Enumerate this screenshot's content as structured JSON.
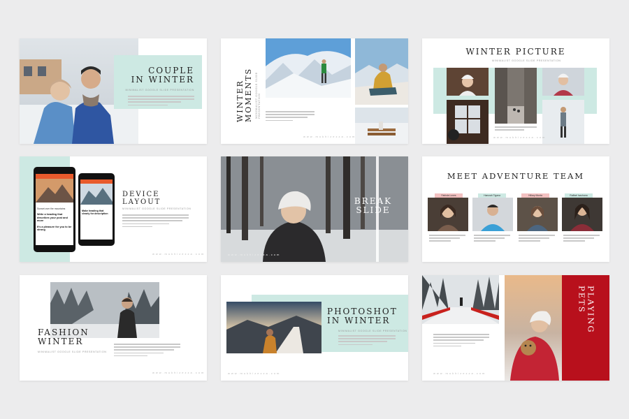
{
  "slides": {
    "couple": {
      "title_line1": "COUPLE",
      "title_line2": "IN WINTER",
      "subtitle": "Minimalist Google Slide Presentation"
    },
    "moments": {
      "title_line1": "WINTER",
      "title_line2": "MOMENTS",
      "subtitle": "Minimalist Google Slide Presentation",
      "url": "www.mukhizezza.com"
    },
    "picture": {
      "title": "WINTER PICTURE",
      "subtitle": "Minimalist Google Slide Presentation",
      "url": "www.mukhizezza.com"
    },
    "device": {
      "title_line1": "DEVICE",
      "title_line2": "LAYOUT",
      "subtitle": "Minimalist Google Slide Presentation",
      "url": "www.mukhizezza.com",
      "phone_text1": "Sunset over the mountains",
      "phone_text2": "Write a heading that describes your post and more",
      "phone_text3": "Make heading that clearly for description",
      "phone_text4": "It's a pleasure for you to be strong"
    },
    "break": {
      "title_line1": "BREAK",
      "title_line2": "SLIDE",
      "url": "www.mukhizezza.com"
    },
    "team": {
      "title": "MEET ADVENTURE TEAM",
      "members": [
        "Fabiola Loves",
        "Hamzah Tigana",
        "Hillary Monta",
        "Raffael Isachana"
      ]
    },
    "fashion": {
      "title_line1": "FASHION",
      "title_line2": "WINTER",
      "subtitle": "Minimalist Google Slide Presentation",
      "url": "www.mukhizezza.com"
    },
    "photoshot": {
      "title_line1": "PHOTOSHOT",
      "title_line2": "IN WINTER",
      "subtitle": "Minimalist Google Slide Presentation",
      "url": "www.mukhizezza.com"
    },
    "pets": {
      "title_line1": "PLAYING",
      "title_line2": "PETS",
      "url": "www.mukhizezza.com"
    }
  },
  "colors": {
    "mint": "#cde9e3",
    "red": "#b8101c",
    "dark": "#222222",
    "background": "#ececed"
  }
}
